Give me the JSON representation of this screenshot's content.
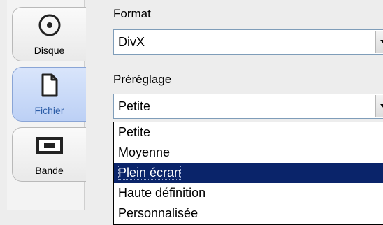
{
  "sidebar": {
    "items": [
      {
        "label": "Disque",
        "icon": "disc-icon",
        "active": false
      },
      {
        "label": "Fichier",
        "icon": "file-icon",
        "active": true
      },
      {
        "label": "Bande",
        "icon": "tape-icon",
        "active": false
      }
    ]
  },
  "format": {
    "label": "Format",
    "value": "DivX"
  },
  "preset": {
    "label": "Préréglage",
    "value": "Petite",
    "options": [
      {
        "label": "Petite",
        "selected": false
      },
      {
        "label": "Moyenne",
        "selected": false
      },
      {
        "label": "Plein écran",
        "selected": true
      },
      {
        "label": "Haute définition",
        "selected": false
      },
      {
        "label": "Personnalisée",
        "selected": false
      }
    ]
  },
  "colors": {
    "highlight": "#0a246a",
    "active_tab": "#bcd0f5"
  }
}
